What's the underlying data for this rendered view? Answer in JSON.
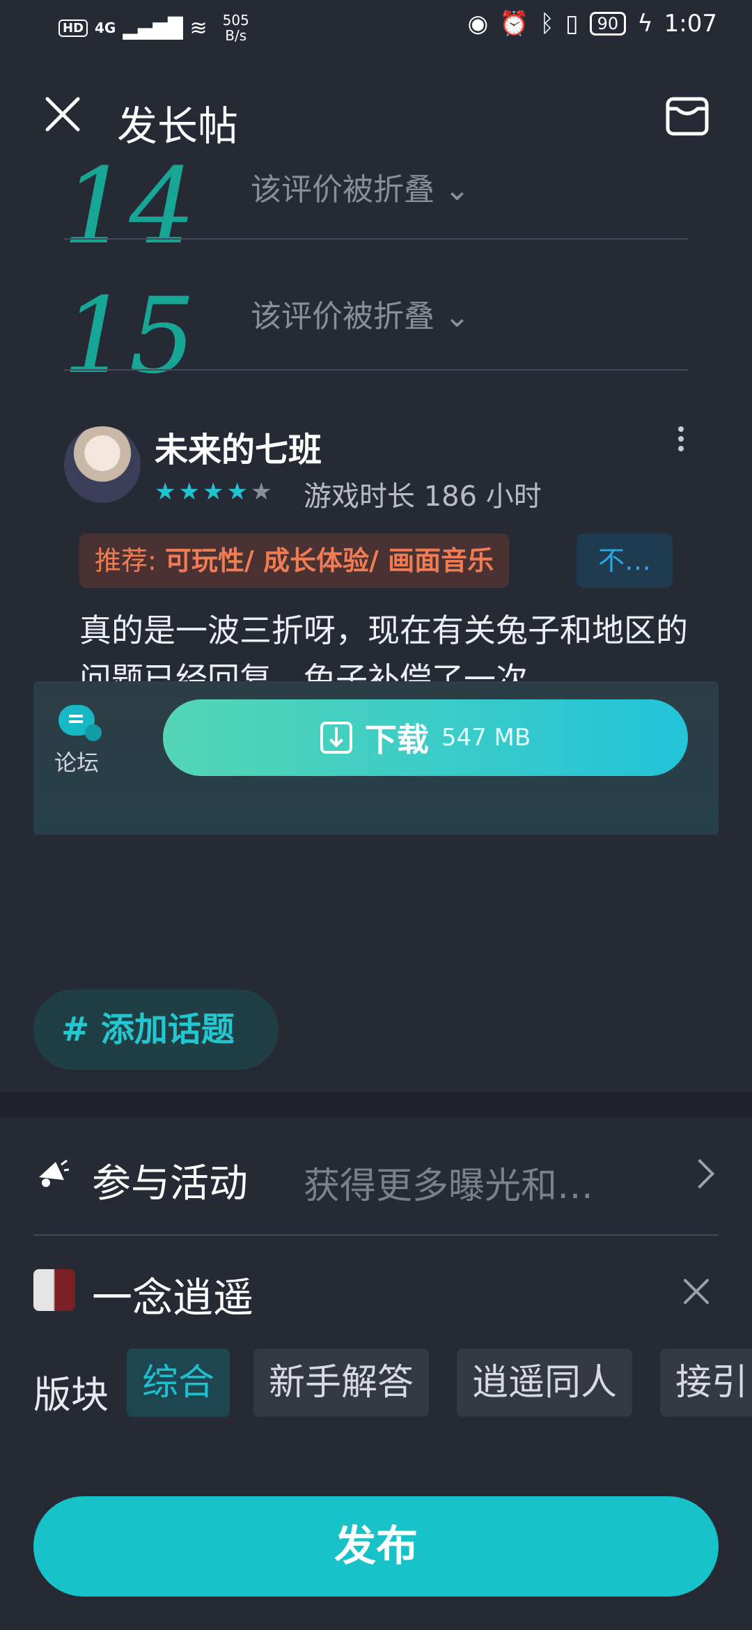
{
  "status_bar": {
    "hd": "HD",
    "net": "4G",
    "speed_value": "505",
    "speed_unit": "B/s",
    "battery": "90",
    "time": "1:07"
  },
  "header": {
    "title": "发长帖"
  },
  "folded_reviews": [
    {
      "handwritten_index": "14",
      "label": "该评价被折叠 ⌄"
    },
    {
      "handwritten_index": "15",
      "label": "该评价被折叠 ⌄"
    }
  ],
  "review": {
    "username": "未来的七班",
    "rating": 4,
    "max_rating": 5,
    "playtime": "游戏时长 186 小时",
    "tag_prefix": "推荐:",
    "tag_items": "可玩性/ 成长体验/ 画面音乐",
    "tag_negative": "不…",
    "text": "真的是一波三折呀，现在有关兔子和地区的问题已经回复，兔子补偿了一次"
  },
  "download_bar": {
    "forum_label": "论坛",
    "download_label": "下载",
    "size": "547 MB"
  },
  "topic": {
    "label": "# 添加话题"
  },
  "activity": {
    "title": "参与活动",
    "subtitle": "获得更多曝光和…"
  },
  "game": {
    "name": "一念逍遥"
  },
  "board": {
    "label": "版块",
    "chips": [
      "综合",
      "新手解答",
      "逍遥同人",
      "接引"
    ],
    "active_index": 0
  },
  "publish": {
    "label": "发布"
  },
  "colors": {
    "background": "#262a35",
    "accent": "#17c2c9",
    "tag_orange": "#ef7c55",
    "handwriting": "#17a596"
  }
}
